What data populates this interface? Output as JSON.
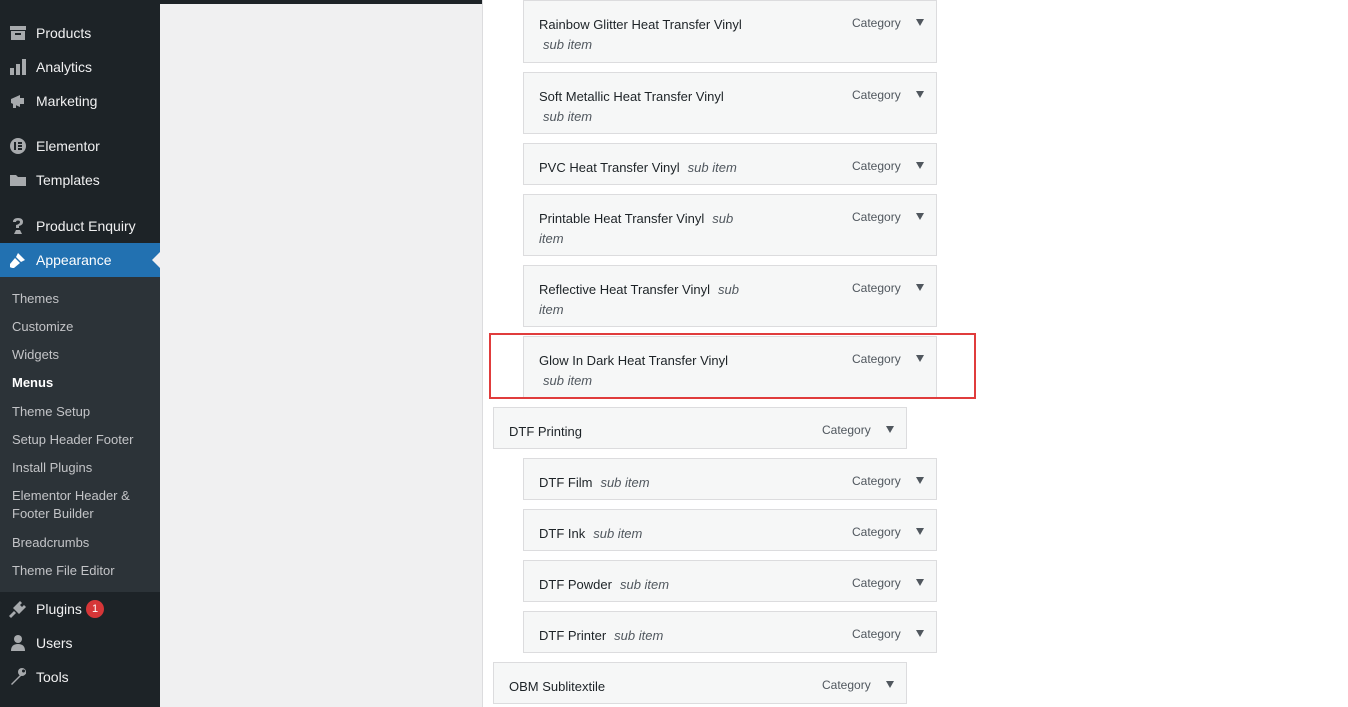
{
  "sidebar": {
    "items": [
      {
        "label": "Products",
        "icon": "archive-icon"
      },
      {
        "label": "Analytics",
        "icon": "bar-chart-icon"
      },
      {
        "label": "Marketing",
        "icon": "megaphone-icon"
      },
      {
        "label": "Elementor",
        "icon": "elementor-icon"
      },
      {
        "label": "Templates",
        "icon": "folder-icon"
      },
      {
        "label": "Product Enquiry",
        "icon": "question-icon"
      },
      {
        "label": "Appearance",
        "icon": "paintbrush-icon"
      },
      {
        "label": "Plugins",
        "icon": "plugin-icon",
        "badge": "1"
      },
      {
        "label": "Users",
        "icon": "user-icon"
      },
      {
        "label": "Tools",
        "icon": "wrench-icon"
      }
    ],
    "appearance_submenu": [
      "Themes",
      "Customize",
      "Widgets",
      "Menus",
      "Theme Setup",
      "Setup Header Footer",
      "Install Plugins",
      "Elementor Header & Footer Builder",
      "Breadcrumbs",
      "Theme File Editor"
    ],
    "active_color": "#2271b1",
    "badge_color": "#d63638"
  },
  "menu_items": [
    {
      "title": "Rainbow Glitter Heat Transfer Vinyl",
      "sub": "sub item",
      "type": "Category"
    },
    {
      "title": "Soft Metallic Heat Transfer Vinyl",
      "sub": "sub item",
      "type": "Category"
    },
    {
      "title": "PVC Heat Transfer Vinyl",
      "sub": "sub item",
      "type": "Category"
    },
    {
      "title": "Printable Heat Transfer Vinyl",
      "sub": "sub item",
      "type": "Category"
    },
    {
      "title": "Reflective Heat Transfer Vinyl",
      "sub": "sub item",
      "type": "Category"
    },
    {
      "title": "Glow In Dark Heat Transfer Vinyl",
      "sub": "sub item",
      "type": "Category",
      "highlighted": true
    },
    {
      "title": "DTF Printing",
      "sub": "",
      "type": "Category"
    },
    {
      "title": "DTF Film",
      "sub": "sub item",
      "type": "Category"
    },
    {
      "title": "DTF Ink",
      "sub": "sub item",
      "type": "Category"
    },
    {
      "title": "DTF Powder",
      "sub": "sub item",
      "type": "Category"
    },
    {
      "title": "DTF Printer",
      "sub": "sub item",
      "type": "Category"
    },
    {
      "title": "OBM Sublitextile",
      "sub": "",
      "type": "Category"
    }
  ],
  "highlight_color": "#e03c3c"
}
